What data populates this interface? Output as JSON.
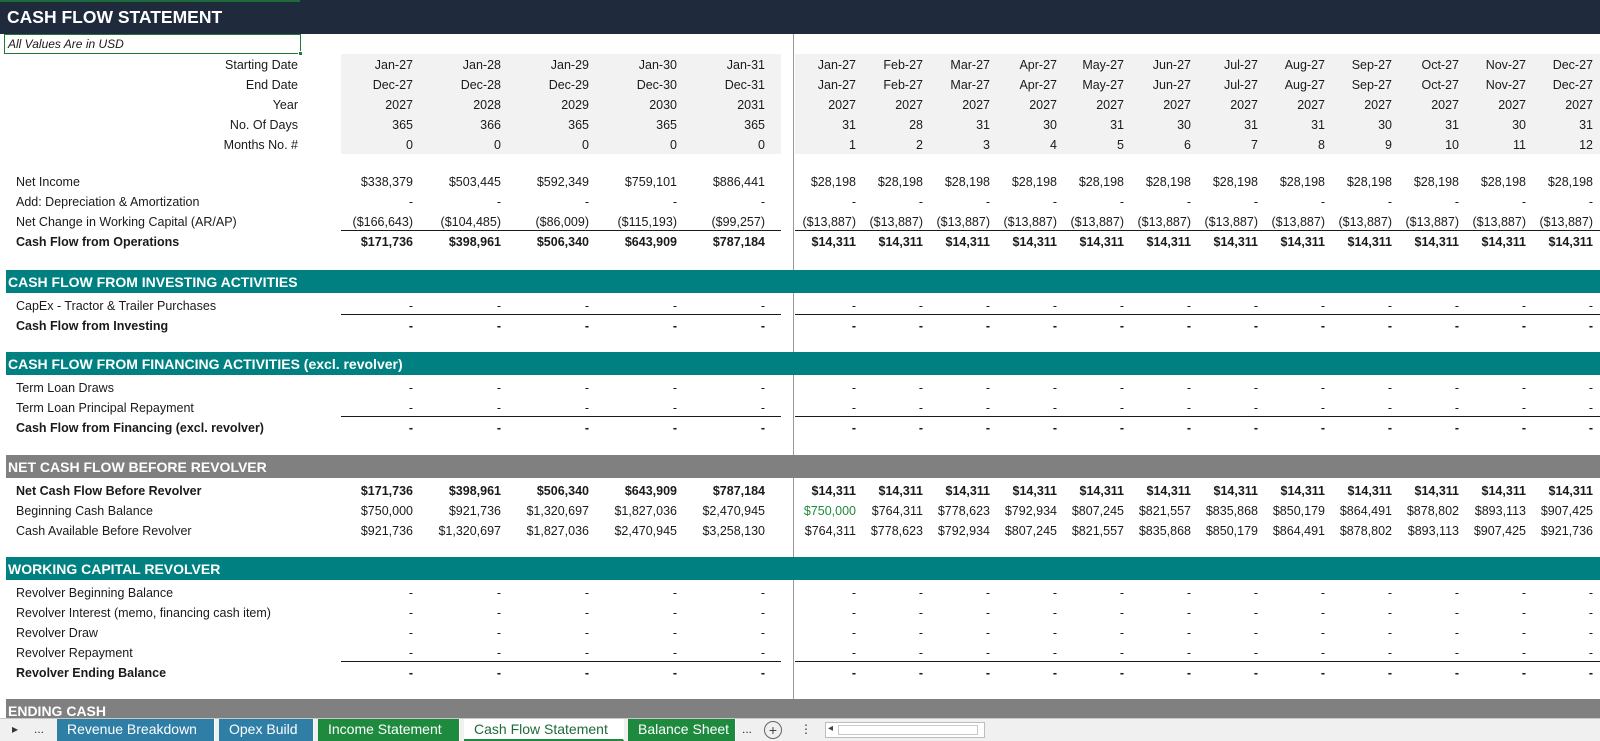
{
  "title": "CASH FLOW STATEMENT",
  "units": "All Values Are in USD",
  "header_rows": [
    {
      "label": "Starting Date",
      "annual": [
        "Jan-27",
        "Jan-28",
        "Jan-29",
        "Jan-30",
        "Jan-31"
      ],
      "monthly": [
        "Jan-27",
        "Feb-27",
        "Mar-27",
        "Apr-27",
        "May-27",
        "Jun-27",
        "Jul-27",
        "Aug-27",
        "Sep-27",
        "Oct-27",
        "Nov-27",
        "Dec-27"
      ]
    },
    {
      "label": "End Date",
      "annual": [
        "Dec-27",
        "Dec-28",
        "Dec-29",
        "Dec-30",
        "Dec-31"
      ],
      "monthly": [
        "Jan-27",
        "Feb-27",
        "Mar-27",
        "Apr-27",
        "May-27",
        "Jun-27",
        "Jul-27",
        "Aug-27",
        "Sep-27",
        "Oct-27",
        "Nov-27",
        "Dec-27"
      ]
    },
    {
      "label": "Year",
      "annual": [
        "2027",
        "2028",
        "2029",
        "2030",
        "2031"
      ],
      "monthly": [
        "2027",
        "2027",
        "2027",
        "2027",
        "2027",
        "2027",
        "2027",
        "2027",
        "2027",
        "2027",
        "2027",
        "2027"
      ]
    },
    {
      "label": "No. Of Days",
      "annual": [
        "365",
        "366",
        "365",
        "365",
        "365"
      ],
      "monthly": [
        "31",
        "28",
        "31",
        "30",
        "31",
        "30",
        "31",
        "31",
        "30",
        "31",
        "30",
        "31"
      ]
    },
    {
      "label": "Months No. #",
      "annual": [
        "0",
        "0",
        "0",
        "0",
        "0"
      ],
      "monthly": [
        "1",
        "2",
        "3",
        "4",
        "5",
        "6",
        "7",
        "8",
        "9",
        "10",
        "11",
        "12"
      ]
    }
  ],
  "operations": [
    {
      "label": "Net Income",
      "bold": false,
      "annual": [
        "$338,379",
        "$503,445",
        "$592,349",
        "$759,101",
        "$886,441"
      ],
      "monthly": [
        "$28,198",
        "$28,198",
        "$28,198",
        "$28,198",
        "$28,198",
        "$28,198",
        "$28,198",
        "$28,198",
        "$28,198",
        "$28,198",
        "$28,198",
        "$28,198"
      ]
    },
    {
      "label": "Add: Depreciation & Amortization",
      "bold": false,
      "annual": [
        "-",
        "-",
        "-",
        "-",
        "-"
      ],
      "monthly": [
        "-",
        "-",
        "-",
        "-",
        "-",
        "-",
        "-",
        "-",
        "-",
        "-",
        "-",
        "-"
      ]
    },
    {
      "label": "Net Change in Working Capital (AR/AP)",
      "bold": false,
      "annual": [
        "($166,643)",
        "($104,485)",
        "($86,009)",
        "($115,193)",
        "($99,257)"
      ],
      "monthly": [
        "($13,887)",
        "($13,887)",
        "($13,887)",
        "($13,887)",
        "($13,887)",
        "($13,887)",
        "($13,887)",
        "($13,887)",
        "($13,887)",
        "($13,887)",
        "($13,887)",
        "($13,887)"
      ]
    },
    {
      "label": "Cash Flow from Operations",
      "bold": true,
      "annual": [
        "$171,736",
        "$398,961",
        "$506,340",
        "$643,909",
        "$787,184"
      ],
      "monthly": [
        "$14,311",
        "$14,311",
        "$14,311",
        "$14,311",
        "$14,311",
        "$14,311",
        "$14,311",
        "$14,311",
        "$14,311",
        "$14,311",
        "$14,311",
        "$14,311"
      ]
    }
  ],
  "investing": {
    "section_title": "CASH FLOW FROM INVESTING ACTIVITIES",
    "rows": [
      {
        "label": "CapEx - Tractor & Trailer Purchases",
        "bold": false,
        "annual": [
          "-",
          "-",
          "-",
          "-",
          "-"
        ],
        "monthly": [
          "-",
          "-",
          "-",
          "-",
          "-",
          "-",
          "-",
          "-",
          "-",
          "-",
          "-",
          "-"
        ]
      },
      {
        "label": "Cash Flow from Investing",
        "bold": true,
        "annual": [
          "-",
          "-",
          "-",
          "-",
          "-"
        ],
        "monthly": [
          "-",
          "-",
          "-",
          "-",
          "-",
          "-",
          "-",
          "-",
          "-",
          "-",
          "-",
          "-"
        ]
      }
    ]
  },
  "financing": {
    "section_title": "CASH FLOW FROM FINANCING ACTIVITIES (excl. revolver)",
    "rows": [
      {
        "label": "Term Loan Draws",
        "bold": false,
        "annual": [
          "-",
          "-",
          "-",
          "-",
          "-"
        ],
        "monthly": [
          "-",
          "-",
          "-",
          "-",
          "-",
          "-",
          "-",
          "-",
          "-",
          "-",
          "-",
          "-"
        ]
      },
      {
        "label": "Term Loan Principal Repayment",
        "bold": false,
        "annual": [
          "-",
          "-",
          "-",
          "-",
          "-"
        ],
        "monthly": [
          "-",
          "-",
          "-",
          "-",
          "-",
          "-",
          "-",
          "-",
          "-",
          "-",
          "-",
          "-"
        ]
      },
      {
        "label": "Cash Flow from Financing (excl. revolver)",
        "bold": true,
        "annual": [
          "-",
          "-",
          "-",
          "-",
          "-"
        ],
        "monthly": [
          "-",
          "-",
          "-",
          "-",
          "-",
          "-",
          "-",
          "-",
          "-",
          "-",
          "-",
          "-"
        ]
      }
    ]
  },
  "net_before_revolver": {
    "section_title": "NET CASH FLOW BEFORE REVOLVER",
    "rows": [
      {
        "label": "Net Cash Flow Before Revolver",
        "bold": true,
        "annual": [
          "$171,736",
          "$398,961",
          "$506,340",
          "$643,909",
          "$787,184"
        ],
        "monthly": [
          "$14,311",
          "$14,311",
          "$14,311",
          "$14,311",
          "$14,311",
          "$14,311",
          "$14,311",
          "$14,311",
          "$14,311",
          "$14,311",
          "$14,311",
          "$14,311"
        ]
      },
      {
        "label": "Beginning Cash Balance",
        "bold": false,
        "annual": [
          "$750,000",
          "$921,736",
          "$1,320,697",
          "$1,827,036",
          "$2,470,945"
        ],
        "monthly": [
          "$750,000",
          "$764,311",
          "$778,623",
          "$792,934",
          "$807,245",
          "$821,557",
          "$835,868",
          "$850,179",
          "$864,491",
          "$878,802",
          "$893,113",
          "$907,425"
        ]
      },
      {
        "label": "Cash Available Before Revolver",
        "bold": false,
        "annual": [
          "$921,736",
          "$1,320,697",
          "$1,827,036",
          "$2,470,945",
          "$3,258,130"
        ],
        "monthly": [
          "$764,311",
          "$778,623",
          "$792,934",
          "$807,245",
          "$821,557",
          "$835,868",
          "$850,179",
          "$864,491",
          "$878,802",
          "$893,113",
          "$907,425",
          "$921,736"
        ]
      }
    ]
  },
  "revolver": {
    "section_title": "WORKING CAPITAL REVOLVER",
    "rows": [
      {
        "label": "Revolver Beginning Balance",
        "bold": false,
        "annual": [
          "-",
          "-",
          "-",
          "-",
          "-"
        ],
        "monthly": [
          "-",
          "-",
          "-",
          "-",
          "-",
          "-",
          "-",
          "-",
          "-",
          "-",
          "-",
          "-"
        ]
      },
      {
        "label": "Revolver Interest (memo, financing cash item)",
        "bold": false,
        "annual": [
          "-",
          "-",
          "-",
          "-",
          "-"
        ],
        "monthly": [
          "-",
          "-",
          "-",
          "-",
          "-",
          "-",
          "-",
          "-",
          "-",
          "-",
          "-",
          "-"
        ]
      },
      {
        "label": "Revolver Draw",
        "bold": false,
        "annual": [
          "-",
          "-",
          "-",
          "-",
          "-"
        ],
        "monthly": [
          "-",
          "-",
          "-",
          "-",
          "-",
          "-",
          "-",
          "-",
          "-",
          "-",
          "-",
          "-"
        ]
      },
      {
        "label": "Revolver Repayment",
        "bold": false,
        "annual": [
          "-",
          "-",
          "-",
          "-",
          "-"
        ],
        "monthly": [
          "-",
          "-",
          "-",
          "-",
          "-",
          "-",
          "-",
          "-",
          "-",
          "-",
          "-",
          "-"
        ]
      },
      {
        "label": "Revolver Ending Balance",
        "bold": true,
        "annual": [
          "-",
          "-",
          "-",
          "-",
          "-"
        ],
        "monthly": [
          "-",
          "-",
          "-",
          "-",
          "-",
          "-",
          "-",
          "-",
          "-",
          "-",
          "-",
          "-"
        ]
      }
    ]
  },
  "ending_cash": {
    "section_title": "ENDING CASH"
  },
  "tabs": [
    {
      "label": "Revenue Breakdown",
      "style": "blue"
    },
    {
      "label": "Opex Build",
      "style": "blue"
    },
    {
      "label": "Income Statement",
      "style": "green"
    },
    {
      "label": "Cash Flow Statement",
      "style": "active"
    },
    {
      "label": "Balance Sheet",
      "style": "green"
    }
  ],
  "tab_nav": {
    "prev": "▸",
    "more_left": "...",
    "more_right": "...",
    "add": "+",
    "options": "⋮"
  },
  "colors": {
    "title_bg": "#1f2a3c",
    "section_teal": "#008080",
    "section_gray": "#808080",
    "tab_blue": "#2e7ea6",
    "tab_green": "#1e8a3e"
  }
}
